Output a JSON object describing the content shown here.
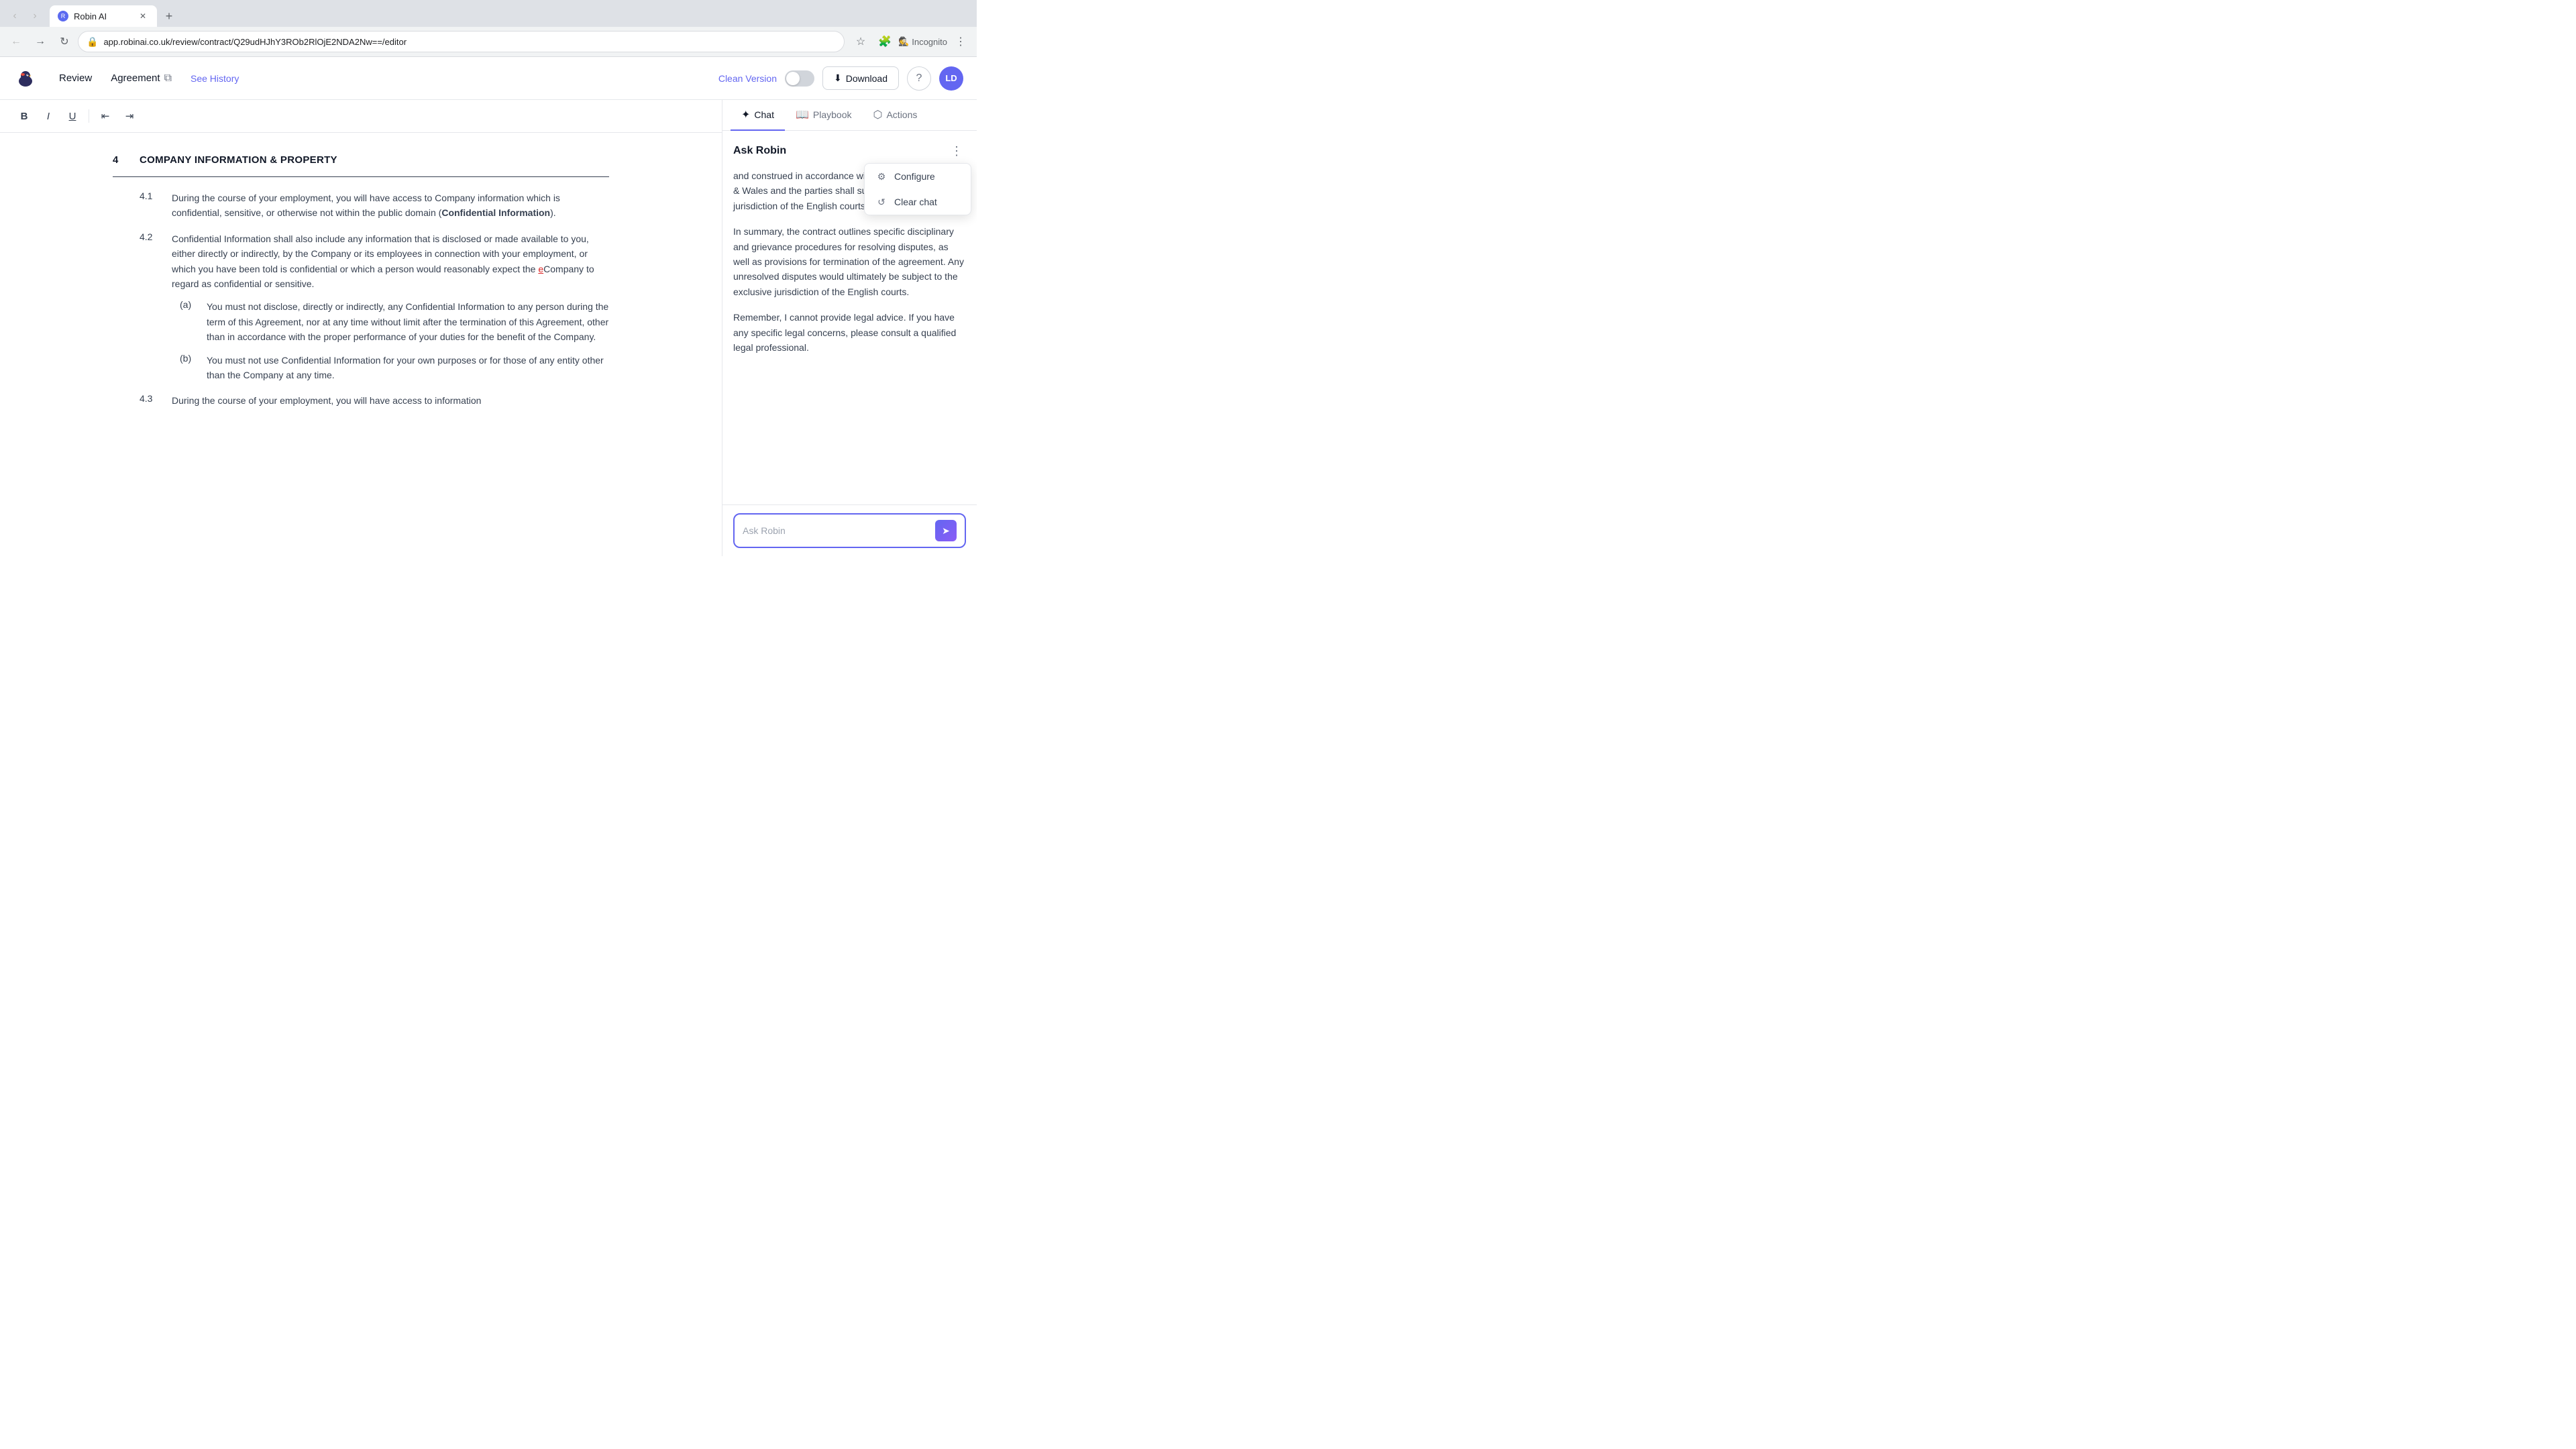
{
  "browser": {
    "tab_label": "Robin AI",
    "url": "app.robinai.co.uk/review/contract/Q29udHJhY3ROb2RlOjE2NDA2Nw==/editor",
    "incognito_label": "Incognito"
  },
  "header": {
    "logo_alt": "Robin AI",
    "nav_review": "Review",
    "doc_title": "Agreement",
    "see_history": "See History",
    "clean_version": "Clean Version",
    "download": "Download",
    "avatar": "LD"
  },
  "toolbar": {
    "bold": "B",
    "italic": "I",
    "underline": "U"
  },
  "document": {
    "section_number": "4",
    "section_title": "COMPANY INFORMATION & PROPERTY",
    "subsections": [
      {
        "number": "4.1",
        "text": "During the course of your employment, you will have access to Company information which is confidential, sensitive, or otherwise not within the public domain (",
        "bold_part": "Confidential Information",
        "text_after": ")."
      },
      {
        "number": "4.2",
        "text": "Confidential Information shall also include any information that is disclosed or made available to you, either directly or indirectly, by the Company or its employees in connection with your employment, or which you have been told is confidential or which a person would reasonably expect the eCompany to regard as confidential or sensitive.",
        "has_highlight": true,
        "highlight_char": "e"
      }
    ],
    "sub_items": [
      {
        "label": "(a)",
        "text": "You must not disclose, directly or indirectly, any Confidential Information to any person during the term of this Agreement, nor at any time without limit after the termination of this Agreement, other than in accordance with the proper performance of your duties for the benefit of the Company."
      },
      {
        "label": "(b)",
        "text": "You must not use Confidential Information for your own purposes or for those of any entity other than the Company at any time."
      }
    ],
    "subsection_43": {
      "number": "4.3",
      "text": "During the course of your employment, you will have access to information"
    }
  },
  "panel": {
    "tabs": [
      {
        "label": "Chat",
        "icon": "✦",
        "active": true
      },
      {
        "label": "Playbook",
        "icon": "📖",
        "active": false
      },
      {
        "label": "Actions",
        "icon": "⬡",
        "active": false
      }
    ],
    "ask_robin_title": "Ask Robin",
    "chat_messages": [
      {
        "text": "and construed in accordance with the laws of England & Wales and the parties shall submit to the exclusive jurisdiction of the English courts."
      },
      {
        "text": "In summary, the contract outlines specific disciplinary and grievance procedures for resolving disputes, as well as provisions for termination of the agreement. Any unresolved disputes would ultimately be subject to the exclusive jurisdiction of the English courts."
      },
      {
        "text": "Remember, I cannot provide legal advice. If you have any specific legal concerns, please consult a qualified legal professional."
      }
    ],
    "input_placeholder": "Ask Robin",
    "dropdown": {
      "items": [
        {
          "label": "Configure",
          "icon": "⚙"
        },
        {
          "label": "Clear chat",
          "icon": "🔄"
        }
      ]
    }
  }
}
